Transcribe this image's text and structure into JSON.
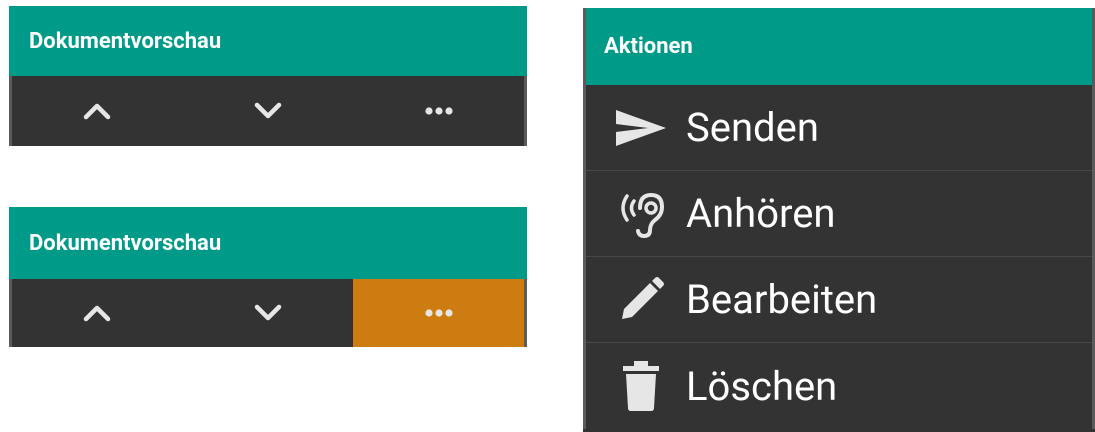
{
  "panel_top": {
    "title": "Dokumentvorschau",
    "buttons": [
      {
        "icon": "chevron-up-icon"
      },
      {
        "icon": "chevron-down-icon"
      },
      {
        "icon": "more-dots-icon"
      }
    ]
  },
  "panel_bottom": {
    "title": "Dokumentvorschau",
    "buttons": [
      {
        "icon": "chevron-up-icon"
      },
      {
        "icon": "chevron-down-icon"
      },
      {
        "icon": "more-dots-icon",
        "active": true
      }
    ]
  },
  "actions": {
    "title": "Aktionen",
    "items": [
      {
        "label": "Senden",
        "icon": "send-icon"
      },
      {
        "label": "Anhören",
        "icon": "hearing-icon"
      },
      {
        "label": "Bearbeiten",
        "icon": "pencil-icon"
      },
      {
        "label": "Löschen",
        "icon": "trash-icon"
      }
    ]
  },
  "colors": {
    "header": "#009a88",
    "toolbar": "#333333",
    "active": "#cc7c10",
    "icon": "#e6e6e6"
  }
}
